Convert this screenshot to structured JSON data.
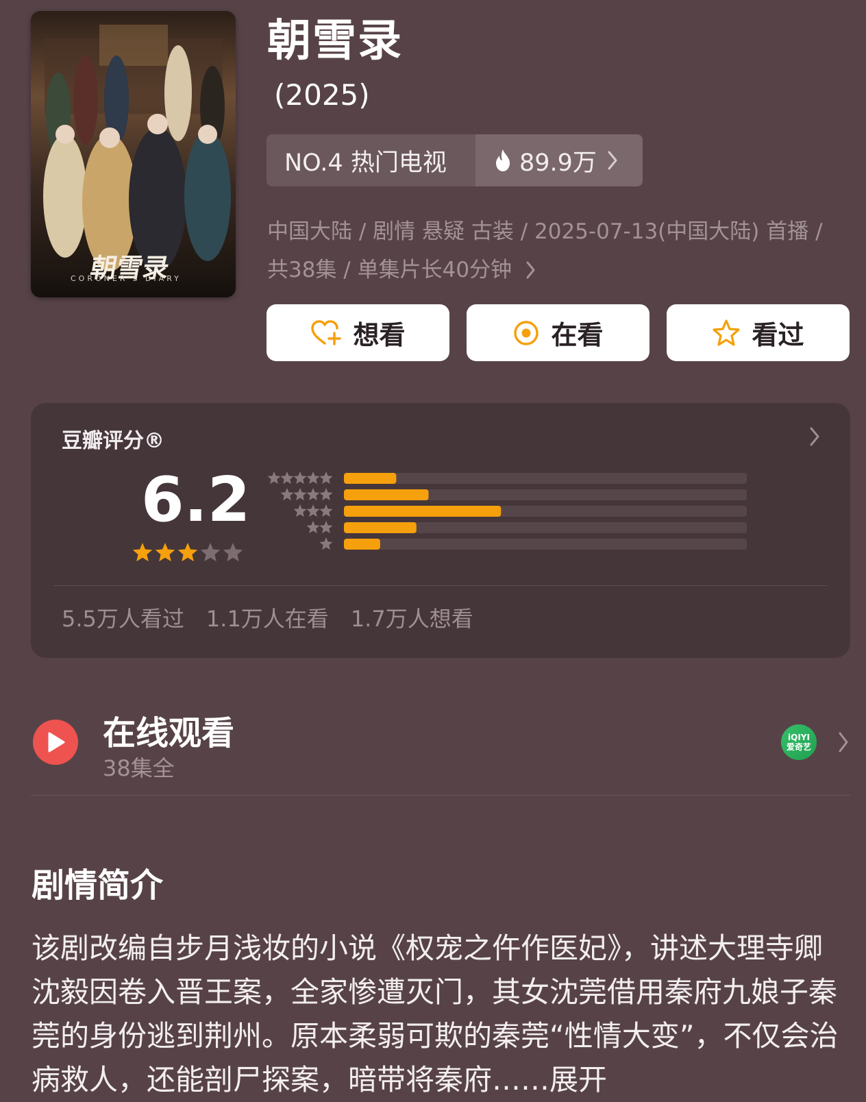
{
  "poster": {
    "title_art": "朝雪录",
    "subtitle_art": "CORONER'S DIARY"
  },
  "show": {
    "title": "朝雪录",
    "year": "(2025)"
  },
  "rank": {
    "label": "NO.4 热门电视",
    "heat": "89.9万"
  },
  "meta": {
    "line1": "中国大陆 / 剧情 悬疑 古装 / 2025-07-13(中国大陆) 首播 /",
    "line2": "共38集 / 单集片长40分钟"
  },
  "buttons": {
    "want": "想看",
    "watching": "在看",
    "watched": "看过"
  },
  "rating": {
    "title": "豆瓣评分®",
    "score": "6.2",
    "stars_filled": 3,
    "stars_total": 5,
    "distribution": [
      {
        "stars": 5,
        "fraction": 0.13
      },
      {
        "stars": 4,
        "fraction": 0.21
      },
      {
        "stars": 3,
        "fraction": 0.39
      },
      {
        "stars": 2,
        "fraction": 0.18
      },
      {
        "stars": 1,
        "fraction": 0.09
      }
    ],
    "stats": [
      "5.5万人看过",
      "1.1万人在看",
      "1.7万人想看"
    ]
  },
  "online": {
    "title": "在线观看",
    "sub": "38集全",
    "platform_latin": "iQIYI",
    "platform_cn": "爱奇艺"
  },
  "synopsis": {
    "title": "剧情简介",
    "text": "该剧改编自步月浅妆的小说《权宠之仵作医妃》，讲述大理寺卿沈毅因卷入晋王案，全家惨遭灭门，其女沈莞借用秦府九娘子秦莞的身份逃到荆州。原本柔弱可欺的秦莞“性情大变”，不仅会治病救人，还能剖尸探案，暗带将秦府……展开"
  },
  "colors": {
    "background": "#574347",
    "accent": "#f5a00c",
    "play": "#ef5350"
  }
}
